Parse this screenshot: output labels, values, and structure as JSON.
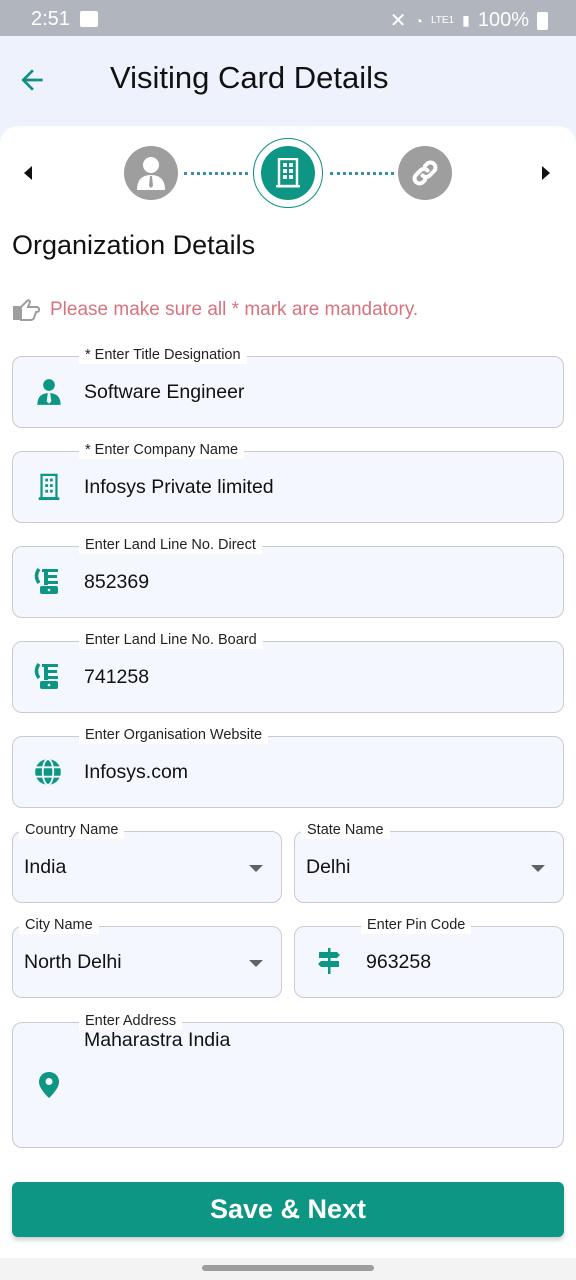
{
  "status_bar": {
    "time": "2:51",
    "battery": "100%",
    "network": "LTE1"
  },
  "app_bar": {
    "title": "Visiting Card Details",
    "back_icon": "arrow-left-icon"
  },
  "stepper": {
    "steps": [
      {
        "icon": "person-icon",
        "state": "inactive"
      },
      {
        "icon": "building-icon",
        "state": "active"
      },
      {
        "icon": "link-icon",
        "state": "inactive"
      }
    ],
    "colors": {
      "active": "#0e9684",
      "inactive": "#9e9e9e"
    }
  },
  "section_title": "Organization Details",
  "notice": {
    "icon": "hand-pointing-icon",
    "text": "Please make sure all * mark are mandatory.",
    "color": "#d9727e"
  },
  "fields": {
    "title_designation": {
      "label": "* Enter Title Designation",
      "value": "Software Engineer",
      "icon": "person-tie-icon"
    },
    "company_name": {
      "label": "* Enter Company Name",
      "value": "Infosys Private limited",
      "icon": "building-icon"
    },
    "landline_direct": {
      "label": "Enter Land Line No. Direct",
      "value": "852369",
      "icon": "telephone-icon"
    },
    "landline_board": {
      "label": "Enter Land Line No. Board",
      "value": "741258",
      "icon": "telephone-icon"
    },
    "website": {
      "label": "Enter Organisation Website",
      "value": "Infosys.com",
      "icon": "globe-icon"
    },
    "country": {
      "label": "Country Name",
      "value": "India"
    },
    "state": {
      "label": "State Name",
      "value": "Delhi"
    },
    "city": {
      "label": "City Name",
      "value": "North Delhi"
    },
    "pin_code": {
      "label": "Enter Pin Code",
      "value": "963258",
      "icon": "signpost-icon"
    },
    "address": {
      "label": "Enter Address",
      "value": "Maharastra India",
      "icon": "location-pin-icon"
    }
  },
  "actions": {
    "save_next": "Save & Next"
  },
  "theme": {
    "accent": "#0e9684"
  }
}
